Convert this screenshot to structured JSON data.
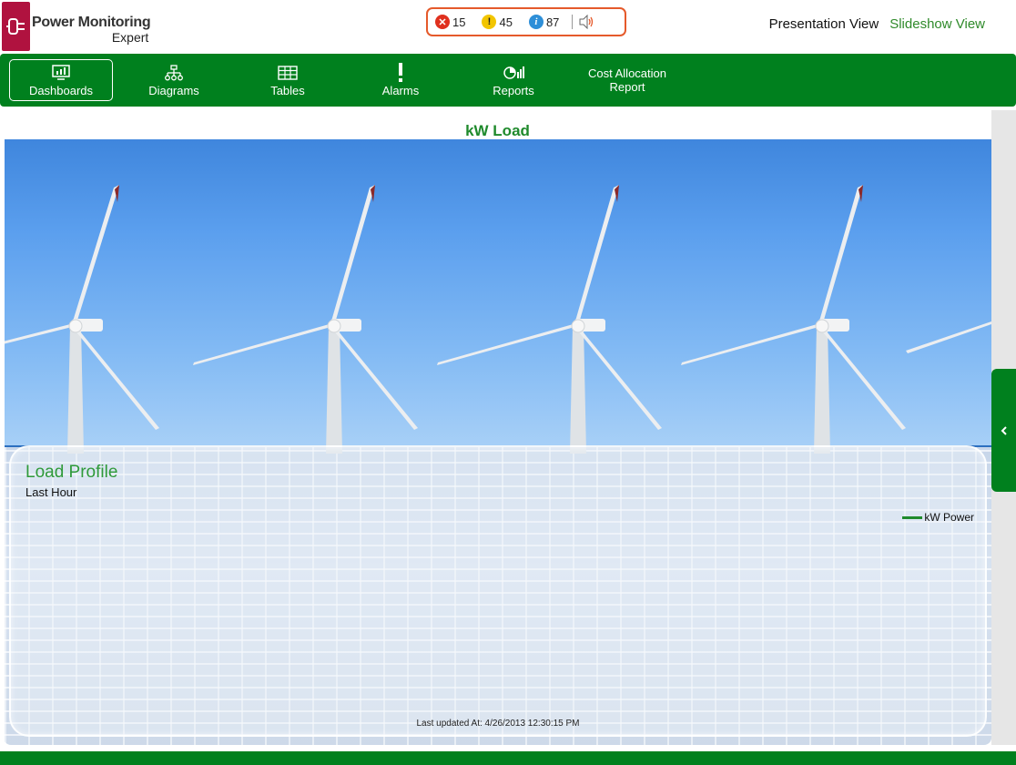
{
  "app": {
    "logo_line1": "Power Monitoring",
    "logo_line2": "Expert"
  },
  "alarms": {
    "high_count": "15",
    "medium_count": "45",
    "low_count": "87"
  },
  "views": {
    "presentation": "Presentation View",
    "slideshow": "Slideshow View"
  },
  "nav": {
    "items": [
      {
        "label": "Dashboards",
        "icon": "dashboard-icon"
      },
      {
        "label": "Diagrams",
        "icon": "diagram-icon"
      },
      {
        "label": "Tables",
        "icon": "table-icon"
      },
      {
        "label": "Alarms",
        "icon": "alarm-icon"
      },
      {
        "label": "Reports",
        "icon": "report-icon"
      },
      {
        "label": "Cost Allocation Report",
        "icon": ""
      }
    ],
    "active": "Dashboards"
  },
  "dashboard": {
    "title": "kW Load",
    "card_title": "Load Profile",
    "card_subtitle": "Last Hour",
    "legend": "kW Power",
    "last_updated": "Last updated At: 4/26/2013 12:30:15 PM"
  },
  "colors": {
    "brand_green": "#00801e",
    "logo_red": "#b0123f",
    "alarm_border": "#e55a2b",
    "title_green": "#1f8a2c"
  }
}
